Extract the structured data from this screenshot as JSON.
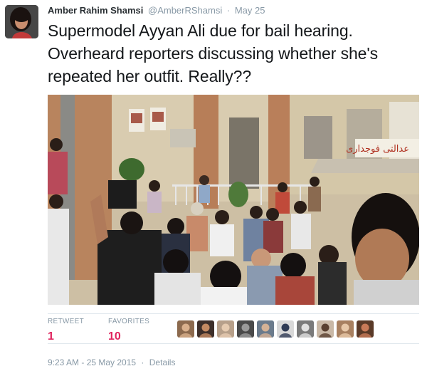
{
  "tweet": {
    "author_name": "Amber Rahim Shamsi",
    "author_handle": "@AmberRShamsi",
    "separator": "·",
    "date": "May 25",
    "text": "Supermodel Ayyan Ali due for bail hearing. Overheard reporters discussing whether she's repeated her outfit. Really??"
  },
  "stats": {
    "retweets_label": "RETWEET",
    "retweets_count": "1",
    "favorites_label": "FAVORITES",
    "favorites_count": "10",
    "count_color": "#e0245e"
  },
  "favoriter_avatars": [
    {
      "name": "favoriter-avatar-1",
      "bg": "#8c6a4e",
      "fg": "#d9b08c"
    },
    {
      "name": "favoriter-avatar-2",
      "bg": "#3d2f2a",
      "fg": "#c48a62"
    },
    {
      "name": "favoriter-avatar-3",
      "bg": "#b7a08a",
      "fg": "#e6cbb0"
    },
    {
      "name": "favoriter-avatar-4",
      "bg": "#4a4a4a",
      "fg": "#9a9a9a"
    },
    {
      "name": "favoriter-avatar-5",
      "bg": "#6b7b8c",
      "fg": "#d4b296"
    },
    {
      "name": "favoriter-avatar-6",
      "bg": "#d8d8d8",
      "fg": "#2f3b55"
    },
    {
      "name": "favoriter-avatar-7",
      "bg": "#7a7a7a",
      "fg": "#e0e0e0"
    },
    {
      "name": "favoriter-avatar-8",
      "bg": "#c9b8a6",
      "fg": "#5a4030"
    },
    {
      "name": "favoriter-avatar-9",
      "bg": "#a88060",
      "fg": "#e8c8a8"
    },
    {
      "name": "favoriter-avatar-10",
      "bg": "#5a3a28",
      "fg": "#c87a58"
    }
  ],
  "footer": {
    "timestamp": "9:23 AM - 25 May 2015",
    "separator": "·",
    "details_label": "Details"
  },
  "photo": {
    "sign_text": "عدالتی فوجداری"
  }
}
